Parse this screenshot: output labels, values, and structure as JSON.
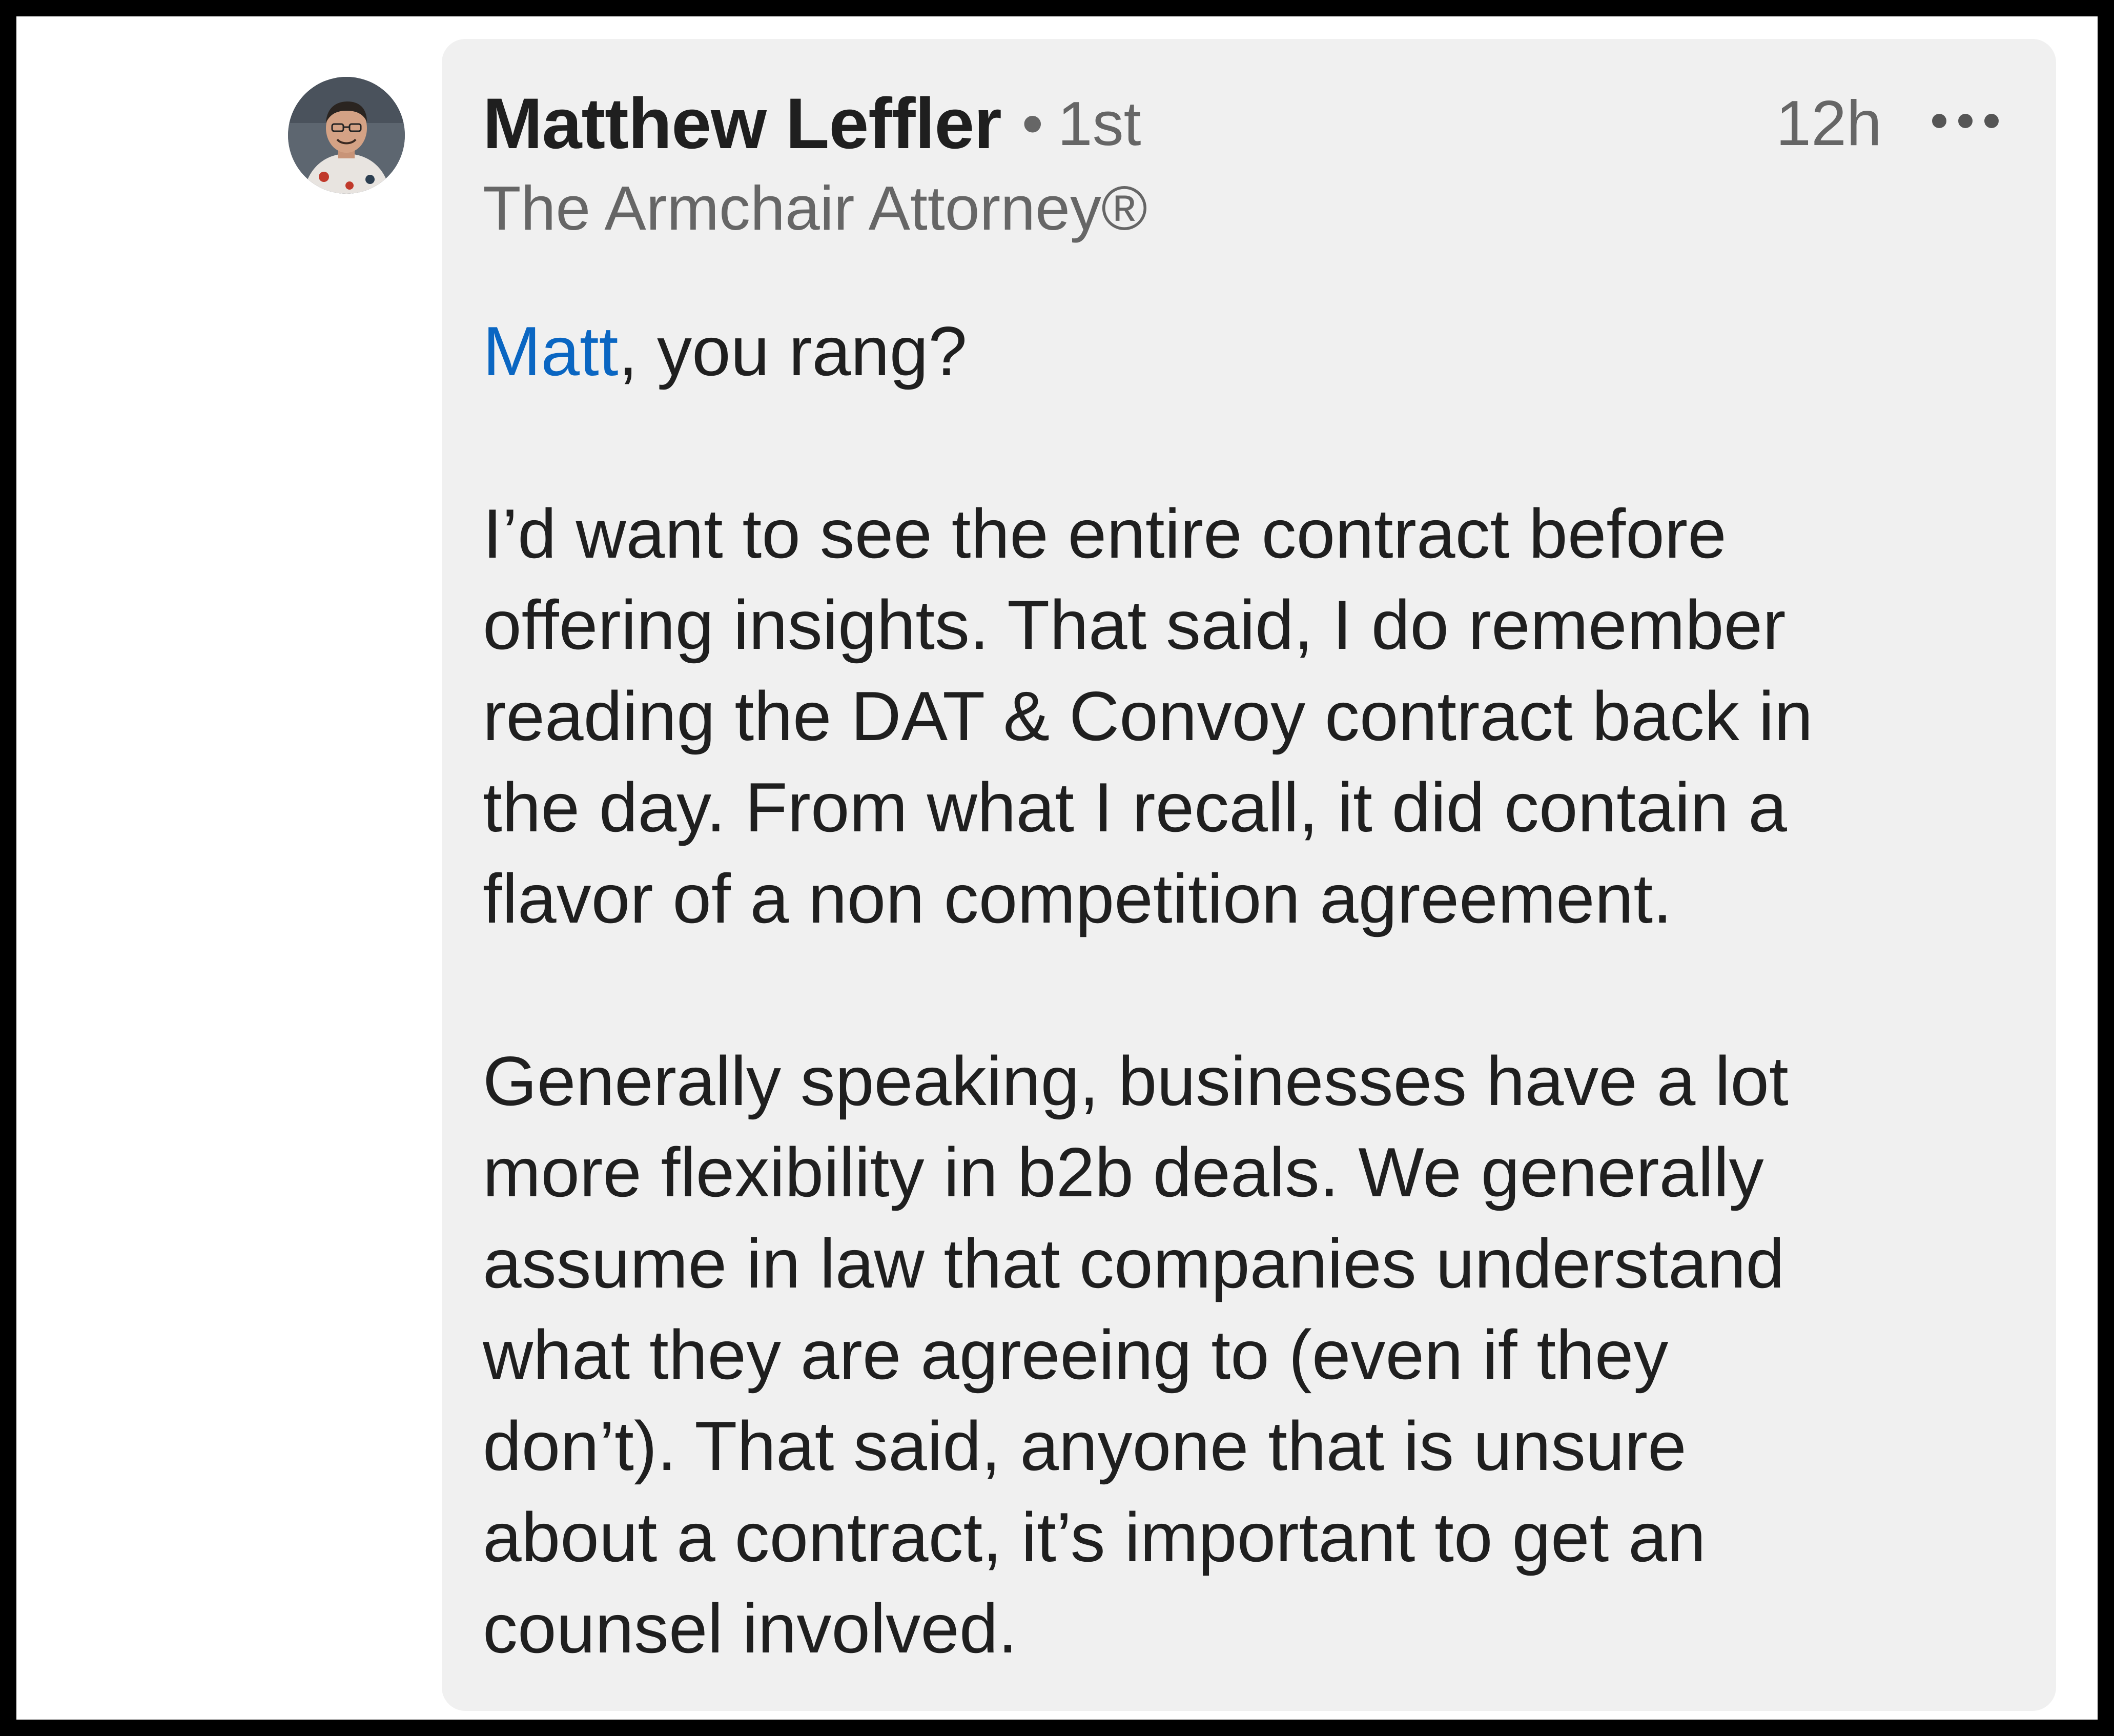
{
  "comment": {
    "author": {
      "name": "Matthew Leffler",
      "separator": "•",
      "connection_degree": "1st",
      "headline": "The Armchair Attorney®"
    },
    "timestamp": "12h",
    "more_icon": "ellipsis-icon",
    "greeting": {
      "mention": "Matt",
      "text": ", you rang?"
    },
    "paragraph_1": [
      "I’d want to see the entire contract before",
      "offering insights. That said, I do remember",
      "reading the DAT & Convoy contract back in",
      "the day. From what I recall, it did contain a",
      "flavor of a non competition agreement."
    ],
    "paragraph_2": [
      "Generally speaking, businesses have a lot",
      "more flexibility in b2b deals. We generally",
      "assume in law that companies understand",
      "what they are agreeing to (even if they",
      "don’t). That said, anyone that is unsure",
      "about a contract, it’s important to get an",
      "counsel involved."
    ]
  },
  "colors": {
    "bubble_bg": "#f0f0f0",
    "text_primary": "#1f1f1f",
    "text_secondary": "#666666",
    "mention_link": "#0a66c2"
  }
}
